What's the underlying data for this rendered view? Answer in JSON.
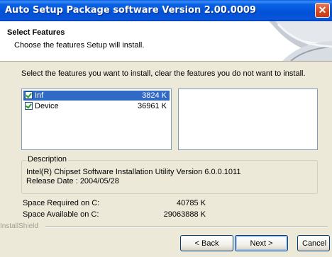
{
  "window": {
    "title": "Auto Setup Package software Version 2.00.0009",
    "close_glyph": "✕"
  },
  "header": {
    "title": "Select Features",
    "subtitle": "Choose the features Setup will install."
  },
  "instruction": "Select the features you want to install, clear the features you do not want to install.",
  "features": [
    {
      "name": "Inf",
      "size": "3824 K",
      "checked": true,
      "selected": true
    },
    {
      "name": "Device",
      "size": "36961 K",
      "checked": true,
      "selected": false
    }
  ],
  "description": {
    "legend": "Description",
    "line1": "Intel(R) Chipset Software Installation Utility Version 6.0.0.1011",
    "line2": "Release Date : 2004/05/28"
  },
  "space": {
    "required_label": "Space Required on  C:",
    "required_value": "40785 K",
    "available_label": "Space Available on  C:",
    "available_value": "29063888 K"
  },
  "brand": "InstallShield",
  "buttons": {
    "back": "< Back",
    "next": "Next >",
    "cancel": "Cancel"
  },
  "colors": {
    "titlebar": "#0051d6",
    "selection": "#316ac5",
    "dialog_bg": "#ece9d8"
  }
}
